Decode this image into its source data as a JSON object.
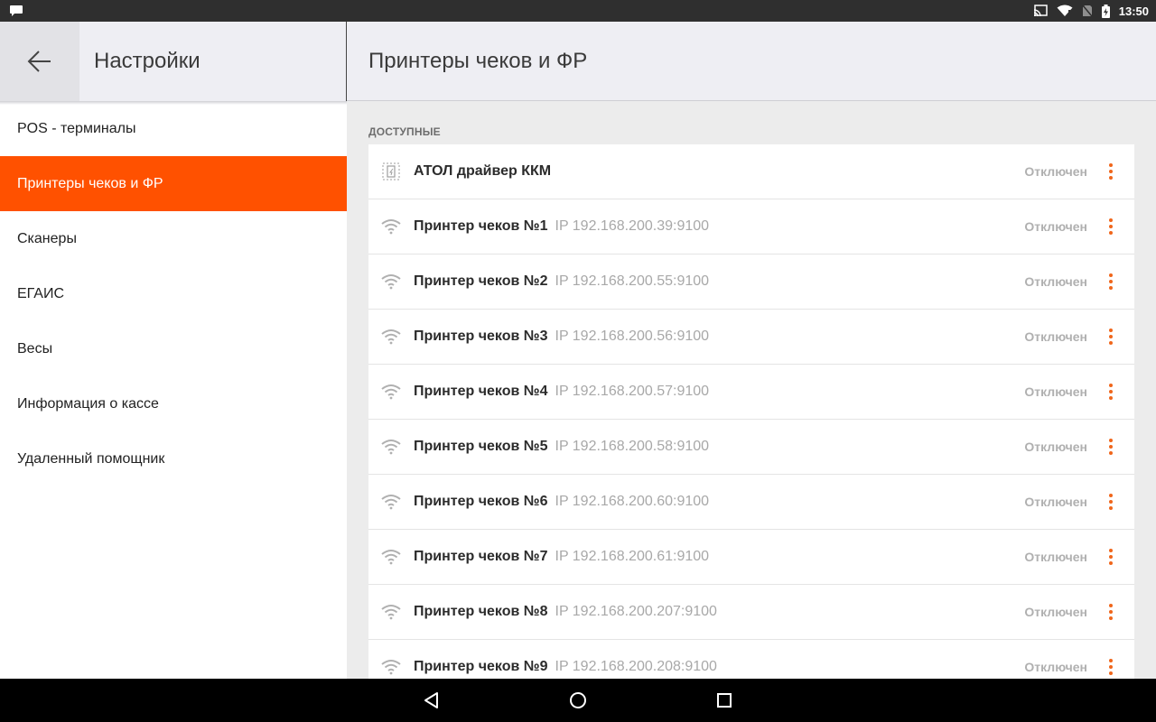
{
  "status_bar": {
    "time": "13:50",
    "icons": [
      "message-icon",
      "cast-icon",
      "wifi-icon",
      "no-sim-icon",
      "battery-charging-icon"
    ]
  },
  "left_header": {
    "title": "Настройки",
    "back_icon": "arrow-back-icon"
  },
  "menu": {
    "items": [
      {
        "label": "POS - терминалы"
      },
      {
        "label": "Принтеры чеков и ФР"
      },
      {
        "label": "Сканеры"
      },
      {
        "label": "ЕГАИС"
      },
      {
        "label": "Весы"
      },
      {
        "label": "Информация о кассе"
      },
      {
        "label": "Удаленный помощник"
      }
    ],
    "active_index": 1
  },
  "right_header": {
    "title": "Принтеры чеков и ФР"
  },
  "section": {
    "label": "ДОСТУПНЫЕ"
  },
  "devices": [
    {
      "icon": "driver-icon",
      "name": "АТОЛ драйвер ККМ",
      "ip": "",
      "status": "Отключен"
    },
    {
      "icon": "wifi-icon",
      "name": "Принтер чеков №1",
      "ip": "IP 192.168.200.39:9100",
      "status": "Отключен"
    },
    {
      "icon": "wifi-icon",
      "name": "Принтер чеков №2",
      "ip": "IP 192.168.200.55:9100",
      "status": "Отключен"
    },
    {
      "icon": "wifi-icon",
      "name": "Принтер чеков №3",
      "ip": "IP 192.168.200.56:9100",
      "status": "Отключен"
    },
    {
      "icon": "wifi-icon",
      "name": "Принтер чеков №4",
      "ip": "IP 192.168.200.57:9100",
      "status": "Отключен"
    },
    {
      "icon": "wifi-icon",
      "name": "Принтер чеков №5",
      "ip": "IP 192.168.200.58:9100",
      "status": "Отключен"
    },
    {
      "icon": "wifi-icon",
      "name": "Принтер чеков №6",
      "ip": "IP 192.168.200.60:9100",
      "status": "Отключен"
    },
    {
      "icon": "wifi-icon",
      "name": "Принтер чеков №7",
      "ip": "IP 192.168.200.61:9100",
      "status": "Отключен"
    },
    {
      "icon": "wifi-icon",
      "name": "Принтер чеков №8",
      "ip": "IP 192.168.200.207:9100",
      "status": "Отключен"
    },
    {
      "icon": "wifi-icon",
      "name": "Принтер чеков №9",
      "ip": "IP 192.168.200.208:9100",
      "status": "Отключен"
    }
  ],
  "nav_bar": {
    "buttons": [
      "nav-back-icon",
      "nav-home-icon",
      "nav-recents-icon"
    ]
  },
  "colors": {
    "accent": "#ff5100",
    "more_dots": "#f0661a"
  }
}
